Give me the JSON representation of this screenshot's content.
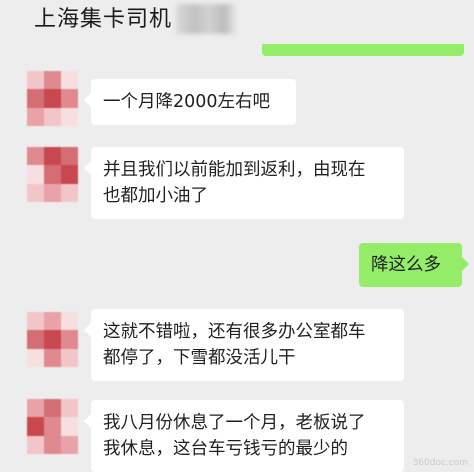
{
  "chat": {
    "title": "上海集卡司机"
  },
  "messages": [
    {
      "side": "left",
      "lines": [
        "一个月降2000左右吧"
      ]
    },
    {
      "side": "left",
      "lines": [
        "并且我们以前能加到返利，由现在",
        "也都加小油了"
      ]
    },
    {
      "side": "right",
      "lines": [
        "降这么多"
      ]
    },
    {
      "side": "left",
      "lines": [
        "这就不错啦，还有很多办公室都车",
        "都停了，下雪都没活儿干"
      ]
    },
    {
      "side": "left",
      "lines": [
        "我八月份休息了一个月，老板说了",
        "我休息，这台车亏钱亏的最少的"
      ]
    }
  ],
  "colors": {
    "background": "#ededed",
    "bubble_left": "#ffffff",
    "bubble_right": "#95ec69",
    "avatar_mosaic": [
      "#e9a3a8",
      "#d46e74",
      "#c9484f",
      "#f2c6c9",
      "#e08a90",
      "#f7dfe0"
    ]
  },
  "watermark": {
    "text": "360doc.com"
  }
}
